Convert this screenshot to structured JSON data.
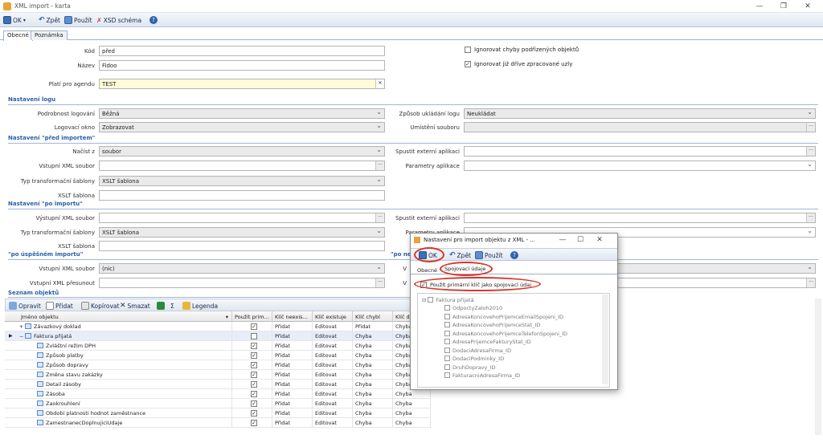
{
  "window": {
    "title": "XML import - karta",
    "minimize": "—",
    "maximize": "❐",
    "close": "✕"
  },
  "toolbar": {
    "ok": "OK",
    "back": "Zpět",
    "use": "Použít",
    "xsd": "XSD schéma"
  },
  "tabs": [
    "Obecné",
    "Poznámka"
  ],
  "form": {
    "kod_label": "Kód",
    "kod_value": "před",
    "nazev_label": "Název",
    "nazev_value": "Fidoo",
    "agenda_label": "Platí pro agendu",
    "agenda_value": "TEST",
    "chk_ignore_errors": "Ignorovat chyby podřízených objektů",
    "chk_ignore_processed": "Ignorovat již dříve zpracované uzly"
  },
  "sec_log": {
    "title": "Nastavení logu",
    "detail_label": "Podrobnost logování",
    "detail_value": "Běžná",
    "window_label": "Logovací okno",
    "window_value": "Zobrazovat",
    "save_label": "Způsob ukládání logu",
    "save_value": "Neukládat",
    "file_label": "Umístění souboru",
    "file_value": ""
  },
  "sec_before": {
    "title": "Nastavení \"před importem\"",
    "load_label": "Načíst z",
    "load_value": "soubor",
    "input_label": "Vstupní XML soubor",
    "input_value": "",
    "type_label": "Typ transformační šablony",
    "type_value": "XSLT šablona",
    "xslt_label": "XSLT šablona",
    "xslt_value": "",
    "ext_label": "Spustit externí aplikaci",
    "ext_value": "",
    "params_label": "Parametry aplikace",
    "params_value": ""
  },
  "sec_after": {
    "title": "Nastavení \"po importu\"",
    "output_label": "Výstupní XML soubor",
    "output_value": "",
    "type_label": "Typ transformační šablony",
    "type_value": "XSLT šablona",
    "xslt_label": "XSLT šablona",
    "xslt_value": "",
    "ext_label": "Spustit externí aplikaci",
    "ext_value": "",
    "params_label": "Parametry aplikace",
    "params_value": ""
  },
  "sec_success": {
    "title": "\"po úspěšném importu\"",
    "output_label": "Vstupní XML soubor",
    "output_value": "(nic)",
    "move_label": "Vstupní XML přesunout",
    "move_value": "",
    "right_prefix": "\"po ne",
    "right_label_prefix": "V"
  },
  "grid": {
    "title": "Seznam objektů",
    "toolbar": {
      "open": "Opravit",
      "add": "Přidat",
      "copy": "Kopírovat",
      "delete": "Smazat",
      "sigma": "Σ",
      "legend": "Legenda"
    },
    "columns": [
      "Jméno objektu",
      "Použít prim...",
      "Klíč neexis...",
      "Klíč existuje",
      "Klíč chybí",
      "Klíč dup"
    ],
    "rows": [
      {
        "name": "Závazkový doklad",
        "checked": true,
        "c1": "Přidat",
        "c2": "Editovat",
        "c3": "Přidat",
        "c4": "Chyba",
        "indent": 0,
        "sel": false,
        "exp": "+"
      },
      {
        "name": "Faktura přijatá",
        "checked": false,
        "c1": "Přidat",
        "c2": "Editovat",
        "c3": "Chyba",
        "c4": "Chyba",
        "indent": 0,
        "sel": true,
        "exp": "−"
      },
      {
        "name": "Zvláštní režim DPH",
        "checked": true,
        "c1": "Přidat",
        "c2": "Editovat",
        "c3": "Chyba",
        "c4": "Chyba",
        "indent": 1,
        "sel": false,
        "exp": ""
      },
      {
        "name": "Způsob platby",
        "checked": true,
        "c1": "Přidat",
        "c2": "Editovat",
        "c3": "Chyba",
        "c4": "Chyba",
        "indent": 1,
        "sel": false,
        "exp": ""
      },
      {
        "name": "Způsob dopravy",
        "checked": true,
        "c1": "Přidat",
        "c2": "Editovat",
        "c3": "Chyba",
        "c4": "Chyba",
        "indent": 1,
        "sel": false,
        "exp": ""
      },
      {
        "name": "Změna stavu zakázky",
        "checked": true,
        "c1": "Přidat",
        "c2": "Editovat",
        "c3": "Chyba",
        "c4": "Chyba",
        "indent": 1,
        "sel": false,
        "exp": ""
      },
      {
        "name": "Detail zásoby",
        "checked": true,
        "c1": "Přidat",
        "c2": "Editovat",
        "c3": "Chyba",
        "c4": "Chyba",
        "indent": 1,
        "sel": false,
        "exp": ""
      },
      {
        "name": "Zásoba",
        "checked": true,
        "c1": "Přidat",
        "c2": "Editovat",
        "c3": "Chyba",
        "c4": "Chyba",
        "indent": 1,
        "sel": false,
        "exp": ""
      },
      {
        "name": "Zaokrouhlení",
        "checked": true,
        "c1": "Přidat",
        "c2": "Editovat",
        "c3": "Chyba",
        "c4": "Chyba",
        "indent": 1,
        "sel": false,
        "exp": ""
      },
      {
        "name": "Období platnosti hodnot zaměstnance",
        "checked": true,
        "c1": "Přidat",
        "c2": "Editovat",
        "c3": "Chyba",
        "c4": "Chyba",
        "indent": 1,
        "sel": false,
        "exp": ""
      },
      {
        "name": "ZamestnanecDoplnujiciUdaje",
        "checked": true,
        "c1": "Přidat",
        "c2": "Editovat",
        "c3": "Chyba",
        "c4": "Chyba",
        "indent": 1,
        "sel": false,
        "exp": ""
      }
    ]
  },
  "dialog": {
    "title": "Nastavení pro import objektu z XML - ...",
    "ok": "OK",
    "back": "Zpět",
    "use": "Použít",
    "tabs": [
      "Obecné",
      "Spojovací údaje"
    ],
    "chk_primary": "Použít primární klíč jako spojovací údaj",
    "tree_root": "Faktura přijatá",
    "tree_items": [
      "OdpoctyZaloh2010",
      "AdresaKoncovehoPrijemceEmailSpojeni_ID",
      "AdresaKoncovehoPrijemceStat_ID",
      "AdresaKoncovehoPrijemceTelefonSpojeni_ID",
      "AdresaPrijemceFakturyStat_ID",
      "DodaciAdresaFirma_ID",
      "DodaciPodminky_ID",
      "DruhDopravy_ID",
      "FakturacniAdresaFirma_ID"
    ]
  }
}
